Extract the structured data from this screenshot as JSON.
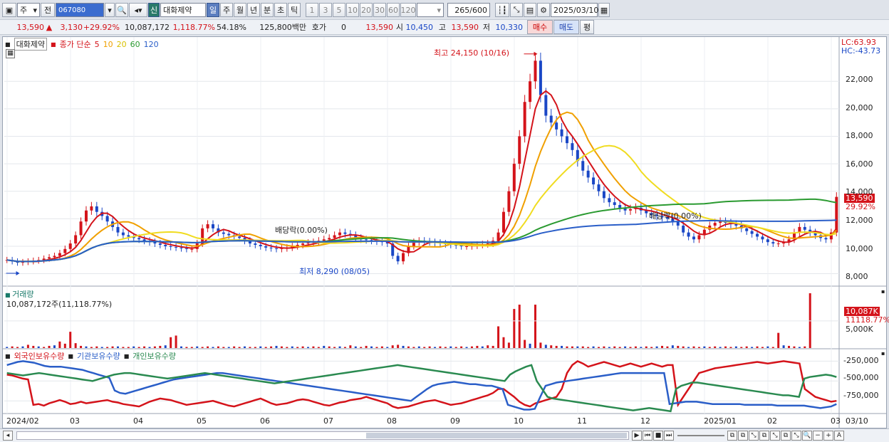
{
  "toolbar": {
    "type_select": "주",
    "prev_button": "전",
    "code": "067080",
    "market_badge": "신",
    "stock_name": "대화제약",
    "periods": [
      "일",
      "주",
      "월",
      "년",
      "분",
      "초",
      "틱"
    ],
    "active_period": "일",
    "intervals": [
      "1",
      "3",
      "5",
      "10",
      "20",
      "30",
      "60",
      "120"
    ],
    "count": "265",
    "count_max": "/600",
    "date": "2025/03/10"
  },
  "quote": {
    "price": "13,590",
    "arrow": "▲",
    "change": "3,130",
    "change_pct": "+29.92%",
    "volume": "10,087,172",
    "volume_pct": "1,118.77%",
    "turnover_pct": "54.18%",
    "value": "125,800백만",
    "hoga_label": "호가",
    "hoga_value": "0",
    "hoga_price": "13,590",
    "open_label": "시",
    "open": "10,450",
    "high_label": "고",
    "high": "13,590",
    "low_label": "저",
    "low": "10,330",
    "buy_button": "매수",
    "sell_button": "매도",
    "eval_button": "평"
  },
  "price_panel": {
    "name": "대화제약",
    "ma_label": "종가 단순",
    "ma": [
      "5",
      "10",
      "20",
      "60",
      "120"
    ],
    "ma_colors": [
      "#d4131a",
      "#f0a000",
      "#f0dc20",
      "#2a9a30",
      "#2a5ec8"
    ],
    "lc": "LC:63.93",
    "hc": "HC:-43.73",
    "high_note": "최고 24,150 (10/16)",
    "low_note": "최저 8,290 (08/05)",
    "div1": "배당락(0.00%)",
    "div2": "배당락(0.00%)",
    "last_price": "13,590",
    "last_pct": "29.92%",
    "y_ticks": [
      "22,000",
      "20,000",
      "18,000",
      "16,000",
      "14,000",
      "12,000",
      "10,000",
      "8,000"
    ]
  },
  "volume_panel": {
    "title": "거래량",
    "value": "10,087,172주(11,118.77%)",
    "last_tag": "10,087K",
    "last_pct": "11118.77%",
    "y_tick": "5,000K"
  },
  "holding_panel": {
    "legend": [
      "외국인보유수량",
      "기관보유수량",
      "개인보유수량"
    ],
    "colors": [
      "#d4131a",
      "#2a5ec8",
      "#2a8a50"
    ],
    "y_ticks": [
      "-250,000",
      "-500,000",
      "-750,000"
    ]
  },
  "x_axis": [
    "2024/02",
    "03",
    "04",
    "05",
    "06",
    "07",
    "08",
    "09",
    "10",
    "11",
    "12",
    "2025/01",
    "02",
    "03"
  ],
  "x_end": "03/10",
  "chart_data": {
    "type": "line",
    "price_range": [
      7200,
      24500
    ],
    "high": 24150,
    "low": 8290,
    "last": 13590,
    "close": [
      9000,
      8900,
      8800,
      8850,
      8900,
      8950,
      9000,
      9100,
      9200,
      9300,
      9500,
      9800,
      10200,
      10800,
      11800,
      12600,
      12900,
      12500,
      12200,
      11800,
      11400,
      11000,
      10800,
      10700,
      10600,
      10500,
      10400,
      10300,
      10200,
      10100,
      10000,
      9950,
      9900,
      9850,
      9800,
      9800,
      10200,
      11300,
      11600,
      11300,
      11000,
      10900,
      10800,
      10700,
      10600,
      10400,
      10200,
      10100,
      10000,
      9900,
      9850,
      9800,
      9850,
      9900,
      10000,
      10100,
      10200,
      10250,
      10300,
      10400,
      10500,
      10600,
      10800,
      11000,
      10900,
      10800,
      10600,
      10500,
      10450,
      10400,
      10350,
      10300,
      10200,
      9300,
      8900,
      9500,
      10000,
      10300,
      10400,
      10350,
      10300,
      10250,
      10200,
      10150,
      10100,
      10050,
      10000,
      10000,
      10050,
      10100,
      10150,
      10200,
      10400,
      11000,
      12500,
      14000,
      16000,
      18000,
      20500,
      22000,
      23500,
      21000,
      19500,
      19000,
      18500,
      18000,
      17500,
      17000,
      16200,
      15500,
      15000,
      14500,
      14000,
      13500,
      13200,
      13000,
      12800,
      12600,
      12700,
      12800,
      12600,
      12400,
      12300,
      12200,
      12100,
      12000,
      11800,
      11500,
      11000,
      10700,
      10500,
      10800,
      11200,
      11500,
      11700,
      11800,
      11700,
      11600,
      11500,
      11300,
      11100,
      10900,
      10700,
      10500,
      10300,
      10200,
      10200,
      10300,
      10500,
      11000,
      11400,
      11200,
      11000,
      10800,
      10600,
      10500,
      11000,
      13590
    ],
    "volume_m": [
      0.2,
      0.3,
      0.2,
      0.3,
      0.6,
      0.4,
      0.3,
      0.2,
      0.4,
      0.5,
      1.2,
      0.8,
      3.0,
      0.9,
      0.4,
      0.3,
      0.2,
      0.3,
      0.2,
      0.2,
      0.3,
      0.3,
      0.2,
      0.2,
      0.3,
      0.2,
      0.3,
      0.2,
      0.3,
      0.4,
      0.5,
      2.0,
      2.3,
      0.3,
      0.2,
      0.2,
      0.3,
      0.2,
      0.3,
      0.2,
      0.3,
      0.2,
      0.2,
      0.3,
      0.2,
      0.3,
      0.2,
      0.2,
      0.3,
      0.2,
      0.3,
      0.4,
      0.3,
      0.2,
      0.3,
      0.2,
      0.3,
      0.2,
      0.3,
      0.2,
      0.4,
      0.3,
      0.2,
      0.3,
      0.2,
      0.5,
      0.3,
      0.2,
      0.4,
      0.3,
      0.2,
      0.3,
      0.2,
      0.5,
      0.6,
      0.4,
      0.3,
      0.2,
      0.3,
      0.2,
      0.3,
      0.2,
      0.3,
      0.2,
      0.3,
      0.2,
      0.3,
      0.2,
      0.3,
      0.4,
      0.3,
      0.5,
      0.4,
      4.0,
      2.0,
      1.0,
      7.2,
      8.0,
      1.5,
      0.8,
      8.0,
      1.0,
      0.6,
      0.5,
      0.4,
      0.4,
      0.3,
      0.3,
      0.3,
      0.3,
      0.2,
      0.3,
      0.2,
      0.3,
      0.2,
      0.3,
      0.2,
      0.3,
      0.2,
      0.3,
      0.2,
      0.3,
      0.2,
      0.3,
      0.4,
      0.3,
      0.5,
      0.4,
      0.3,
      0.2,
      0.3,
      0.2,
      0.3,
      0.2,
      0.3,
      0.2,
      0.3,
      0.2,
      0.3,
      0.2,
      0.3,
      0.2,
      0.3,
      0.2,
      0.3,
      0.2,
      2.8,
      0.5,
      0.4,
      0.3,
      0.2,
      0.3,
      10.1
    ],
    "foreign": [
      -420,
      -430,
      -450,
      -470,
      -480,
      -800,
      -790,
      -810,
      -780,
      -760,
      -740,
      -760,
      -790,
      -780,
      -760,
      -780,
      -770,
      -760,
      -750,
      -740,
      -760,
      -770,
      -790,
      -800,
      -810,
      -820,
      -790,
      -760,
      -740,
      -720,
      -730,
      -740,
      -760,
      -780,
      -800,
      -790,
      -780,
      -770,
      -760,
      -750,
      -770,
      -790,
      -810,
      -820,
      -800,
      -780,
      -760,
      -740,
      -720,
      -750,
      -780,
      -800,
      -790,
      -780,
      -760,
      -740,
      -730,
      -740,
      -760,
      -780,
      -800,
      -810,
      -790,
      -770,
      -760,
      -740,
      -730,
      -720,
      -700,
      -720,
      -740,
      -760,
      -780,
      -820,
      -840,
      -830,
      -820,
      -800,
      -780,
      -760,
      -750,
      -740,
      -760,
      -780,
      -800,
      -790,
      -780,
      -760,
      -740,
      -720,
      -700,
      -680,
      -650,
      -600,
      -600,
      -650,
      -700,
      -760,
      -800,
      -820,
      -780,
      -760,
      -740,
      -720,
      -700,
      -600,
      -400,
      -300,
      -250,
      -280,
      -320,
      -300,
      -280,
      -260,
      -280,
      -300,
      -320,
      -300,
      -280,
      -300,
      -320,
      -300,
      -280,
      -300,
      -320,
      -300,
      -300,
      -800,
      -700,
      -600,
      -500,
      -400,
      -380,
      -360,
      -340,
      -330,
      -320,
      -310,
      -300,
      -290,
      -280,
      -270,
      -260,
      -270,
      -280,
      -270,
      -260,
      -250,
      -260,
      -270,
      -280,
      -600,
      -650,
      -700,
      -720,
      -740,
      -760,
      -750
    ],
    "institution": [
      -300,
      -280,
      -260,
      -250,
      -260,
      -270,
      -290,
      -310,
      -320,
      -320,
      -320,
      -330,
      -340,
      -350,
      -360,
      -380,
      -400,
      -420,
      -440,
      -460,
      -620,
      -650,
      -660,
      -640,
      -620,
      -600,
      -580,
      -560,
      -540,
      -520,
      -500,
      -480,
      -470,
      -460,
      -450,
      -440,
      -430,
      -420,
      -410,
      -400,
      -400,
      -410,
      -420,
      -430,
      -440,
      -450,
      -460,
      -470,
      -480,
      -490,
      -500,
      -510,
      -520,
      -530,
      -540,
      -550,
      -560,
      -570,
      -580,
      -590,
      -600,
      -610,
      -620,
      -630,
      -640,
      -650,
      -660,
      -670,
      -680,
      -690,
      -700,
      -710,
      -720,
      -730,
      -740,
      -750,
      -700,
      -650,
      -600,
      -560,
      -540,
      -530,
      -520,
      -510,
      -520,
      -530,
      -540,
      -540,
      -550,
      -560,
      -560,
      -580,
      -600,
      -800,
      -820,
      -840,
      -860,
      -860,
      -850,
      -700,
      -560,
      -540,
      -520,
      -510,
      -500,
      -490,
      -480,
      -470,
      -460,
      -450,
      -440,
      -430,
      -420,
      -410,
      -400,
      -400,
      -400,
      -400,
      -400,
      -400,
      -400,
      -400,
      -400,
      -790,
      -780,
      -770,
      -760,
      -760,
      -760,
      -770,
      -780,
      -790,
      -790,
      -790,
      -790,
      -790,
      -790,
      -800,
      -800,
      -800,
      -800,
      -800,
      -800,
      -810,
      -810,
      -810,
      -810,
      -810,
      -810,
      -820,
      -830,
      -840,
      -830,
      -820,
      -790
    ],
    "individual": [
      -400,
      -410,
      -420,
      -430,
      -420,
      -410,
      -400,
      -410,
      -420,
      -430,
      -440,
      -450,
      -460,
      -470,
      -480,
      -490,
      -500,
      -480,
      -460,
      -440,
      -420,
      -410,
      -400,
      -400,
      -410,
      -420,
      -430,
      -440,
      -450,
      -460,
      -470,
      -460,
      -450,
      -440,
      -430,
      -420,
      -410,
      -400,
      -410,
      -420,
      -430,
      -440,
      -450,
      -460,
      -470,
      -480,
      -490,
      -500,
      -510,
      -520,
      -530,
      -520,
      -510,
      -500,
      -490,
      -480,
      -470,
      -460,
      -450,
      -440,
      -430,
      -420,
      -410,
      -400,
      -390,
      -380,
      -370,
      -360,
      -350,
      -340,
      -330,
      -320,
      -310,
      -300,
      -310,
      -320,
      -330,
      -340,
      -350,
      -360,
      -370,
      -380,
      -390,
      -400,
      -410,
      -420,
      -430,
      -440,
      -450,
      -460,
      -470,
      -480,
      -490,
      -500,
      -420,
      -380,
      -350,
      -320,
      -300,
      -500,
      -600,
      -700,
      -720,
      -730,
      -740,
      -750,
      -760,
      -770,
      -780,
      -790,
      -800,
      -810,
      -820,
      -830,
      -840,
      -850,
      -860,
      -870,
      -860,
      -850,
      -840,
      -850,
      -860,
      -870,
      -880,
      -600,
      -560,
      -540,
      -520,
      -520,
      -530,
      -540,
      -550,
      -560,
      -570,
      -580,
      -590,
      -600,
      -610,
      -620,
      -630,
      -640,
      -650,
      -660,
      -670,
      -680,
      -680,
      -690,
      -700,
      -470,
      -450,
      -440,
      -430,
      -420,
      -430,
      -450
    ]
  }
}
